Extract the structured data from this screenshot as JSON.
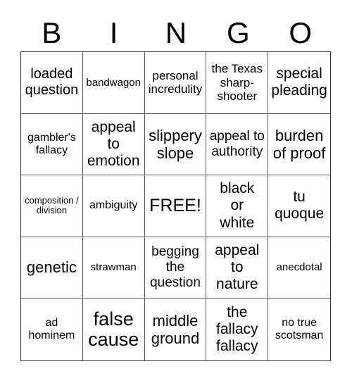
{
  "header": {
    "letters": [
      "B",
      "I",
      "N",
      "G",
      "O"
    ]
  },
  "cells": [
    "loaded question",
    "bandwagon",
    "personal incredulity",
    "the Texas sharp-shooter",
    "special pleading",
    "gambler's fallacy",
    "appeal to emotion",
    "slippery slope",
    "appeal to authority",
    "burden of proof",
    "composition / division",
    "ambiguity",
    "FREE!",
    "black or white",
    "tu quoque",
    "genetic",
    "strawman",
    "begging the question",
    "appeal to nature",
    "anecdotal",
    "ad hominem",
    "false cause",
    "middle ground",
    "the fallacy fallacy",
    "no true scotsman"
  ]
}
